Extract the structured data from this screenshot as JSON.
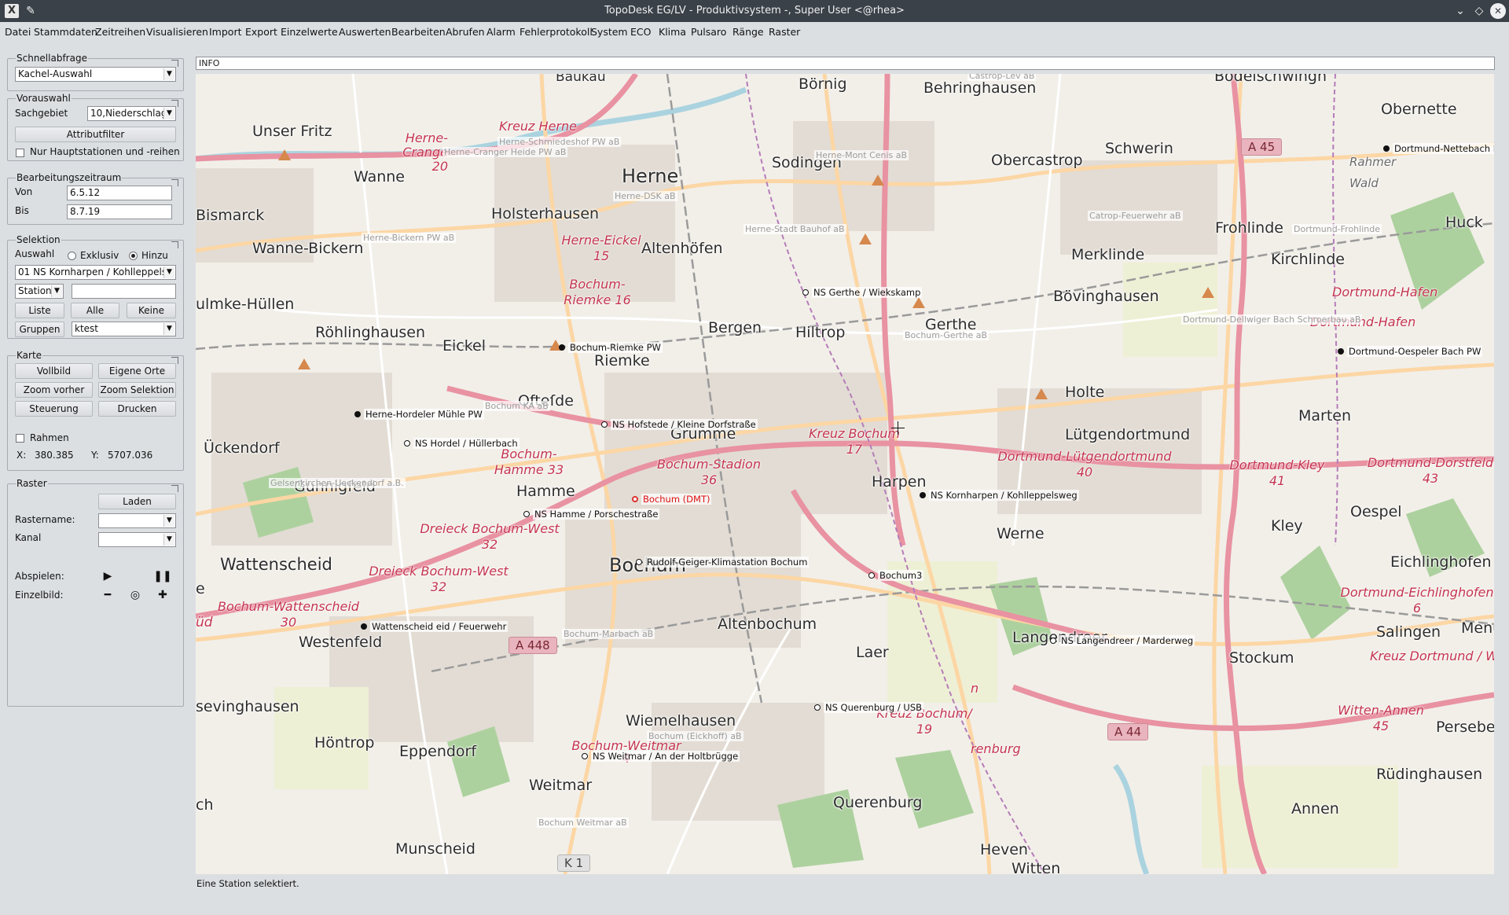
{
  "window": {
    "title": "TopoDesk EG/LV - Produktivsystem -, Super User <@rhea>",
    "app_icon": "X",
    "icons": [
      "app-icon",
      "pin-icon",
      "chevron-down-icon",
      "diamond-icon",
      "close-icon"
    ]
  },
  "menu": [
    {
      "label": "Datei"
    },
    {
      "label": "Stammdaten"
    },
    {
      "label": "Zeitreihen"
    },
    {
      "label": "Visualisieren"
    },
    {
      "label": "Import"
    },
    {
      "label": "Export"
    },
    {
      "label": "Einzelwerte"
    },
    {
      "label": "Auswerten"
    },
    {
      "label": "Bearbeiten"
    },
    {
      "label": "Abrufen"
    },
    {
      "label": "Alarm"
    },
    {
      "label": "Fehlerprotokoll"
    },
    {
      "label": "System"
    },
    {
      "label": "ECO"
    },
    {
      "label": "Klima"
    },
    {
      "label": "Pulsaro"
    },
    {
      "label": "Ränge"
    },
    {
      "label": "Raster"
    }
  ],
  "schnellabfrage": {
    "title": "Schnellabfrage",
    "selected": "Kachel-Auswahl"
  },
  "vorauswahl": {
    "title": "Vorauswahl",
    "sachgebiet_label": "Sachgebiet",
    "sachgebiet_value": "10,Niederschlag",
    "attributfilter_label": "Attributfilter",
    "hauptstationen_label": "Nur Hauptstationen und -reihen",
    "hauptstationen_checked": false
  },
  "bearbeitungszeitraum": {
    "title": "Bearbeitungszeitraum",
    "von_label": "Von",
    "von_value": "6.5.12",
    "bis_label": "Bis",
    "bis_value": "8.7.19"
  },
  "selektion": {
    "title": "Selektion",
    "auswahl_label": "Auswahl",
    "exklusiv_label": "Exklusiv",
    "hinzu_label": "Hinzu",
    "mode": "Hinzu",
    "auswahl_value": "01 NS Kornharpen / Kohlleppelsw",
    "type_value": "Station",
    "search_value": "",
    "liste_label": "Liste",
    "alle_label": "Alle",
    "keine_label": "Keine",
    "gruppen_label": "Gruppen",
    "gruppen_value": "ktest"
  },
  "karte": {
    "title": "Karte",
    "vollbild_label": "Vollbild",
    "eigene_orte_label": "Eigene Orte",
    "zoom_vorher_label": "Zoom vorher",
    "zoom_selektion_label": "Zoom Selektion",
    "steuerung_label": "Steuerung",
    "drucken_label": "Drucken",
    "rahmen_label": "Rahmen",
    "rahmen_checked": false,
    "x_label": "X:",
    "x_value": "380.385",
    "y_label": "Y:",
    "y_value": "5707.036"
  },
  "raster": {
    "title": "Raster",
    "laden_label": "Laden",
    "rastername_label": "Rastername:",
    "rastername_value": "",
    "kanal_label": "Kanal",
    "kanal_value": "",
    "abspielen_label": "Abspielen:",
    "einzelbild_label": "Einzelbild:",
    "media_icons": [
      "play-icon",
      "pause-icon",
      "minus-icon",
      "target-icon",
      "plus-icon"
    ]
  },
  "info_field": {
    "value": "INFO"
  },
  "map": {
    "places": [
      {
        "text": "Baukau"
      },
      {
        "text": "Börnig"
      },
      {
        "text": "Behringhausen"
      },
      {
        "text": "Unser Fritz"
      },
      {
        "text": "Wanne"
      },
      {
        "text": "Herne"
      },
      {
        "text": "Sodingen"
      },
      {
        "text": "Obercastrop"
      },
      {
        "text": "Schwerin"
      },
      {
        "text": "Bismarck"
      },
      {
        "text": "Holsterhausen"
      },
      {
        "text": "Frohlinde"
      },
      {
        "text": "Merklinde"
      },
      {
        "text": "Kirchlinde"
      },
      {
        "text": "Huck"
      },
      {
        "text": "Obernette"
      },
      {
        "text": "Wanne-Bickern"
      },
      {
        "text": "Altenhöfen"
      },
      {
        "text": "ulmke-Hüllen"
      },
      {
        "text": "Röhlinghausen"
      },
      {
        "text": "Eickel"
      },
      {
        "text": "Riemke"
      },
      {
        "text": "Bergen"
      },
      {
        "text": "Hiltrop"
      },
      {
        "text": "Gerthe"
      },
      {
        "text": "Bövinghausen"
      },
      {
        "text": "Holte"
      },
      {
        "text": "Marten"
      },
      {
        "text": "Ückendorf"
      },
      {
        "text": "Grumme"
      },
      {
        "text": "Lütgendortmund"
      },
      {
        "text": "Harpen"
      },
      {
        "text": "Hamme"
      },
      {
        "text": "Gunnigfeld"
      },
      {
        "text": "Werne"
      },
      {
        "text": "Kley"
      },
      {
        "text": "Oespel"
      },
      {
        "text": "Wattenscheid"
      },
      {
        "text": "Bochum"
      },
      {
        "text": "Eichlinghofen"
      },
      {
        "text": "Westenfeld"
      },
      {
        "text": "Altenbochum"
      },
      {
        "text": "Laer"
      },
      {
        "text": "Salingen"
      },
      {
        "text": "Langendreer"
      },
      {
        "text": "Stockum"
      },
      {
        "text": "sevinghausen"
      },
      {
        "text": "Höntrop"
      },
      {
        "text": "Eppendorf"
      },
      {
        "text": "Wiemelhausen"
      },
      {
        "text": "Persebec"
      },
      {
        "text": "Weitmar"
      },
      {
        "text": "Querenburg"
      },
      {
        "text": "Rüdinghausen"
      },
      {
        "text": "Annen"
      },
      {
        "text": "Munscheid"
      },
      {
        "text": "Heven"
      },
      {
        "text": "Witten"
      },
      {
        "text": "Ofteſde"
      },
      {
        "text": "ch"
      },
      {
        "text": "e"
      },
      {
        "text": "üd"
      },
      {
        "text": "Menu"
      },
      {
        "text": "Rahmer Wald"
      },
      {
        "text": "Lütgendortmund"
      },
      {
        "text": "Bodelschwingh"
      }
    ],
    "junctions": [
      {
        "text": "Kreuz Herne"
      },
      {
        "text": "Herne-Crange 20"
      },
      {
        "text": "Herne-Eickel 15"
      },
      {
        "text": "Bochum-Riemke 16"
      },
      {
        "text": "Bochum-Hamme 33"
      },
      {
        "text": "Bochum-Stadion 36"
      },
      {
        "text": "Kreuz Bochum 17"
      },
      {
        "text": "Dortmund-Lütgendortmund 40"
      },
      {
        "text": "Dortmund-Kley 41"
      },
      {
        "text": "Dortmund-Dorstfeld 43"
      },
      {
        "text": "Dreieck Bochum-West 32"
      },
      {
        "text": "Dreieck Bochum-West 32"
      },
      {
        "text": "Bochum-Wattenscheid 30"
      },
      {
        "text": "Dortmund-Hafen"
      },
      {
        "text": "Dortmund-Hafen"
      },
      {
        "text": "Dortmund-Eichlinghofen 6"
      },
      {
        "text": "Kreuz Dortmund / W"
      },
      {
        "text": "Witten-Annen 45"
      },
      {
        "text": "Kreuz Bochum/ 19"
      },
      {
        "text": "Bochum-Weitmar 4"
      },
      {
        "text": "renburg"
      },
      {
        "text": "n"
      }
    ],
    "grey_labels": [
      {
        "text": "Castrop-Lev aB"
      },
      {
        "text": "Herne-Schmiedeshof PW aB"
      },
      {
        "text": "Herne-Cranger Heide PW aB"
      },
      {
        "text": "Herne-Mont Cenis aB"
      },
      {
        "text": "Herne-DSK aB"
      },
      {
        "text": "Herne-Stadt Bauhof aB"
      },
      {
        "text": "Catrop-Feuerwehr aB"
      },
      {
        "text": "Dortmund-Frohlinde"
      },
      {
        "text": "Herne-Bickern PW aB"
      },
      {
        "text": "Dortmund-Dellwiger Bach Schroerbau aB"
      },
      {
        "text": "Bochum-Gerthe aB"
      },
      {
        "text": "Bochum KA aB"
      },
      {
        "text": "Gelsenkirchen-Ueckendorf a.B."
      },
      {
        "text": "Bochum-Marbach aB"
      },
      {
        "text": "Bochum (Eickhoff) aB"
      },
      {
        "text": "Bochum Weitmar aB"
      }
    ],
    "stations": [
      {
        "text": "Dortmund-Nettebach PW"
      },
      {
        "text": "NS Gerthe / Wiekskamp"
      },
      {
        "text": "Bochum-Riemke PW"
      },
      {
        "text": "Dortmund-Oespeler Bach PW"
      },
      {
        "text": "Herne-Hordeler Mühle PW"
      },
      {
        "text": "NS Hofstede / Kleine Dorfstraße"
      },
      {
        "text": "NS Hordel / Hüllerbach"
      },
      {
        "text": "Bochum (DMT)"
      },
      {
        "text": "NS Kornharpen / Kohlleppelsweg"
      },
      {
        "text": "NS Hamme / Porschestraße"
      },
      {
        "text": "Rudolf-Geiger-Klimastation Bochum"
      },
      {
        "text": "Bochum3"
      },
      {
        "text": "Wattenscheid eid / Feuerwehr"
      },
      {
        "text": "NS Langendreer / Marderweg"
      },
      {
        "text": "NS Querenburg / USB"
      },
      {
        "text": "NS Weitmar / An der Holtbrügge"
      }
    ],
    "shields": [
      {
        "text": "A 45"
      },
      {
        "text": "A 448"
      },
      {
        "text": "A 44"
      },
      {
        "text": "K 1"
      }
    ],
    "colors": {
      "land": "#f2efe9",
      "motorway": "#e892a2",
      "primary": "#fcd6a4",
      "rail": "#9a9a9a",
      "forest": "#add19e",
      "water": "#aad3df",
      "station_highlight": "#dd2222"
    }
  },
  "status": {
    "text": "Eine Station selektiert."
  }
}
